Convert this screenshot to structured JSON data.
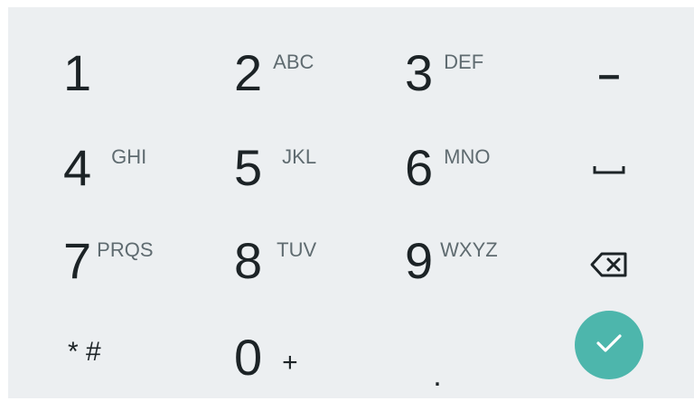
{
  "keys": {
    "k1": {
      "digit": "1",
      "letters": ""
    },
    "k2": {
      "digit": "2",
      "letters": "ABC"
    },
    "k3": {
      "digit": "3",
      "letters": "DEF"
    },
    "k4": {
      "digit": "4",
      "letters": "GHI"
    },
    "k5": {
      "digit": "5",
      "letters": "JKL"
    },
    "k6": {
      "digit": "6",
      "letters": "MNO"
    },
    "k7": {
      "digit": "7",
      "letters": "PRQS"
    },
    "k8": {
      "digit": "8",
      "letters": "TUV"
    },
    "k9": {
      "digit": "9",
      "letters": "WXYZ"
    },
    "k0": {
      "digit": "0",
      "letters": "+"
    }
  },
  "special": {
    "minus": "–",
    "star_hash": "* #",
    "period": "."
  },
  "icons": {
    "space": "space-icon",
    "backspace": "backspace-icon",
    "done": "check-icon"
  },
  "colors": {
    "background": "#eceff1",
    "text": "#1c2326",
    "secondary_text": "#5f6b70",
    "accent": "#4db6ac"
  }
}
